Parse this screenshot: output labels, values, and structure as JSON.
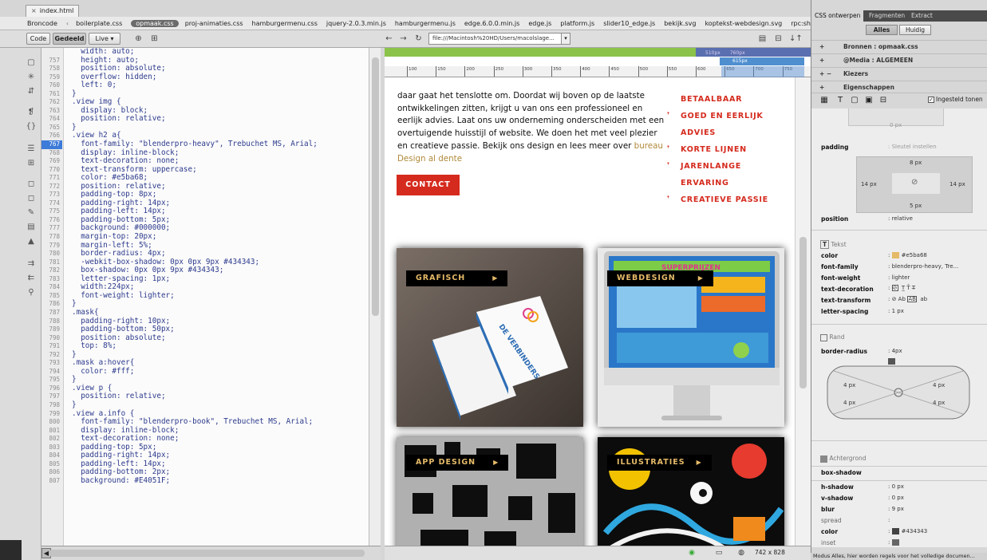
{
  "document": {
    "tab": "index.html"
  },
  "related_files": [
    "Broncode",
    "boilerplate.css",
    "opmaak.css",
    "proj-animaties.css",
    "hamburgermenu.css",
    "jquery-2.0.3.min.js",
    "hamburgermenu.js",
    "edge.6.0.0.min.js",
    "edge.js",
    "platform.js",
    "slider10_edge.js",
    "bekijk.svg",
    "koptekst-webdesign.svg",
    "rpc:shindig_random.js"
  ],
  "toolbar": {
    "code": "Code",
    "split": "Gedeeld",
    "live": "Live",
    "address": "file:///Macintosh%20HD/Users/macolslage...",
    "live_dropdown": "▾"
  },
  "code_lines": [
    {
      "n": "",
      "t": "  width: auto;"
    },
    {
      "n": "757",
      "t": "  height: auto;"
    },
    {
      "n": "758",
      "t": "  position: absolute;"
    },
    {
      "n": "759",
      "t": "  overflow: hidden;"
    },
    {
      "n": "760",
      "t": "  left: 0;"
    },
    {
      "n": "761",
      "t": "}"
    },
    {
      "n": "762",
      "t": ".view img {"
    },
    {
      "n": "763",
      "t": "  display: block;"
    },
    {
      "n": "764",
      "t": "  position: relative;"
    },
    {
      "n": "765",
      "t": "}"
    },
    {
      "n": "766",
      "t": ".view h2 a{"
    },
    {
      "n": "767",
      "t": "  font-family: \"blenderpro-heavy\", Trebuchet MS, Arial;"
    },
    {
      "n": "768",
      "t": "  display: inline-block;"
    },
    {
      "n": "769",
      "t": "  text-decoration: none;"
    },
    {
      "n": "770",
      "t": "  text-transform: uppercase;"
    },
    {
      "n": "771",
      "t": "  color: #e5ba68;"
    },
    {
      "n": "772",
      "t": "  position: relative;"
    },
    {
      "n": "773",
      "t": "  padding-top: 8px;"
    },
    {
      "n": "774",
      "t": "  padding-right: 14px;"
    },
    {
      "n": "775",
      "t": "  padding-left: 14px;"
    },
    {
      "n": "776",
      "t": "  padding-bottom: 5px;"
    },
    {
      "n": "777",
      "t": "  background: #000000;"
    },
    {
      "n": "778",
      "t": "  margin-top: 20px;"
    },
    {
      "n": "779",
      "t": "  margin-left: 5%;"
    },
    {
      "n": "780",
      "t": "  border-radius: 4px;"
    },
    {
      "n": "781",
      "t": "  -webkit-box-shadow: 0px 0px 9px #434343;"
    },
    {
      "n": "782",
      "t": "  box-shadow: 0px 0px 9px #434343;"
    },
    {
      "n": "783",
      "t": "  letter-spacing: 1px;"
    },
    {
      "n": "784",
      "t": "  width:224px;"
    },
    {
      "n": "785",
      "t": "  font-weight: lighter;"
    },
    {
      "n": "786",
      "t": "}"
    },
    {
      "n": "787",
      "t": ".mask{"
    },
    {
      "n": "788",
      "t": "  padding-right: 10px;"
    },
    {
      "n": "789",
      "t": "  padding-bottom: 50px;"
    },
    {
      "n": "790",
      "t": "  position: absolute;"
    },
    {
      "n": "791",
      "t": "  top: 8%;"
    },
    {
      "n": "792",
      "t": "}"
    },
    {
      "n": "793",
      "t": ".mask a:hover{"
    },
    {
      "n": "794",
      "t": "  color: #fff;"
    },
    {
      "n": "795",
      "t": "}"
    },
    {
      "n": "796",
      "t": ".view p {"
    },
    {
      "n": "797",
      "t": "  position: relative;"
    },
    {
      "n": "798",
      "t": "}"
    },
    {
      "n": "799",
      "t": ".view a.info {"
    },
    {
      "n": "800",
      "t": "  font-family: \"blenderpro-book\", Trebuchet MS, Arial;"
    },
    {
      "n": "801",
      "t": "  display: inline-block;"
    },
    {
      "n": "802",
      "t": "  text-decoration: none;"
    },
    {
      "n": "803",
      "t": "  padding-top: 5px;"
    },
    {
      "n": "804",
      "t": "  padding-right: 14px;"
    },
    {
      "n": "805",
      "t": "  padding-left: 14px;"
    },
    {
      "n": "806",
      "t": "  padding-bottom: 2px;"
    },
    {
      "n": "807",
      "t": "  background: #E4051F;"
    }
  ],
  "live": {
    "ruler_ticks": [
      "100",
      "150",
      "200",
      "250",
      "300",
      "350",
      "400",
      "450",
      "500",
      "550",
      "600",
      "650",
      "700",
      "750"
    ],
    "mq_labels": [
      "510px",
      "760px"
    ],
    "mq_blue_label": "615px",
    "intro_text": "daar gaat het tenslotte om. Doordat wij boven op de laatste ontwikkelingen zitten, krijgt u van ons een professioneel en eerlijk advies. Laat ons uw onderneming onderscheiden met een overtuigende huisstijl of website. We doen het met veel plezier en creatieve passie. Bekijk ons design en lees meer over",
    "intro_link": "bureau Design al dente",
    "contact_label": "CONTACT",
    "usp_items": [
      "BETAALBAAR",
      "GOED EN EERLIJK ADVIES",
      "KORTE LIJNEN",
      "JARENLANGE ERVARING",
      "CREATIEVE PASSIE"
    ],
    "tiles": [
      {
        "label": "GRAFISCH",
        "arrow": "▶"
      },
      {
        "label": "WEBDESIGN",
        "arrow": "▶"
      },
      {
        "label": "APP DESIGN",
        "arrow": "▶"
      },
      {
        "label": "ILLUSTRATIES",
        "arrow": "▶"
      }
    ],
    "card_brand": "DE VERBINDERS",
    "screen_headline": "SUPERPRIJZEN",
    "dimensions": "742 x 828"
  },
  "panel": {
    "tabs": [
      "CSS ontwerpen",
      "Fragmenten",
      "Extract"
    ],
    "seg": [
      "Alles",
      "Huidig"
    ],
    "sources": "Bronnen : opmaak.css",
    "media": "@Media : ALGEMEEN",
    "selectors": "Kiezers",
    "properties": "Eigenschappen",
    "show_set": "Ingesteld tonen",
    "margin_bottom": "0 px",
    "padding_label": "padding",
    "padding_link": ": Sleutel instellen",
    "padding_top": "8 px",
    "padding_left": "14 px",
    "padding_right": "14 px",
    "padding_bottom": "5 px",
    "position_label": "position",
    "position_value": ": relative",
    "text_section": "Tekst",
    "color_label": "color",
    "color_value": "#e5ba68",
    "font_family_label": "font-family",
    "font_family_value": ": blenderpro-heavy, Tre...",
    "font_weight_label": "font-weight",
    "font_weight_value": ": lighter",
    "text_decoration_label": "text-decoration",
    "text_transform_label": "text-transform",
    "letter_spacing_label": "letter-spacing",
    "letter_spacing_value": ": 1 px",
    "border_section": "Rand",
    "border_radius_label": "border-radius",
    "border_radius_value": ": 4px",
    "radius_tl": "4 px",
    "radius_tr": "4 px",
    "radius_bl": "4 px",
    "radius_br": "4 px",
    "bg_section": "Achtergrond",
    "box_shadow_label": "box-shadow",
    "h_shadow_label": "h-shadow",
    "h_shadow_value": ": 0 px",
    "v_shadow_label": "v-shadow",
    "v_shadow_value": ": 0 px",
    "blur_label": "blur",
    "blur_value": ": 9 px",
    "spread_label": "spread",
    "spread_value": ":",
    "shadow_color_label": "color",
    "shadow_color_value": "#434343",
    "inset_label": "inset",
    "inset_value": ":",
    "status": "Modus Alles, hier worden regels voor het volledige documen..."
  },
  "colors": {
    "accent_red": "#d52b1e",
    "gold": "#e5ba68",
    "mq_green": "#8bc34a",
    "mq_blue": "#5a6fb0",
    "selection": "#3d7bd9"
  }
}
